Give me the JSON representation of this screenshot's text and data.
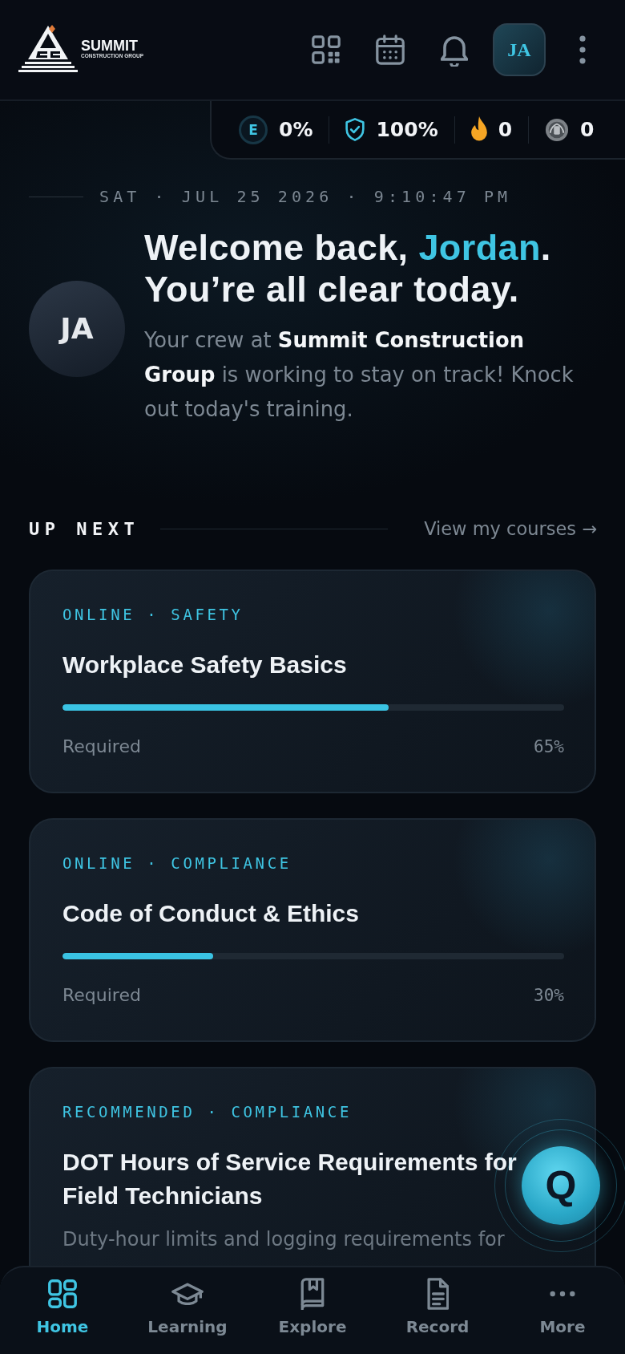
{
  "header": {
    "logo": {
      "name": "SUMMIT",
      "subtitle": "CONSTRUCTION GROUP"
    },
    "avatar_initials": "JA"
  },
  "stats": [
    {
      "kind": "energy",
      "symbol": "E",
      "value": "0%"
    },
    {
      "kind": "shield",
      "value": "100%"
    },
    {
      "kind": "streak",
      "value": "0"
    },
    {
      "kind": "medal",
      "value": "0"
    }
  ],
  "greeting": {
    "date_line": "SAT · JUL 25 2026 · 9:10:47 PM",
    "avatar_initials": "JA",
    "heading_prefix": "Welcome back, ",
    "name": "Jordan",
    "heading_suffix": ".",
    "subheading": "You’re all clear today.",
    "message": "Your crew at **Summit Construction Group** is working to stay on track! Knock out today's training."
  },
  "up_next": {
    "title": "UP NEXT",
    "link": "View my courses →",
    "courses": [
      {
        "tag": "ONLINE · SAFETY",
        "title": "Workplace Safety Basics",
        "level": 0.65,
        "requirement": "Required",
        "percent": "65%"
      },
      {
        "tag": "ONLINE · COMPLIANCE",
        "title": "Code of Conduct & Ethics",
        "level": 0.3,
        "requirement": "Required",
        "percent": "30%"
      },
      {
        "tag": "RECOMMENDED · COMPLIANCE",
        "title": "DOT Hours of Service Requirements for Field Technicians",
        "description": "Duty-hour limits and logging requirements for"
      }
    ]
  },
  "fab": {
    "label": "Q"
  },
  "nav": [
    {
      "kind": "home",
      "label": "Home",
      "selected": true
    },
    {
      "kind": "learning",
      "label": "Learning",
      "selected": false
    },
    {
      "kind": "explore",
      "label": "Explore",
      "selected": false
    },
    {
      "kind": "record",
      "label": "Record",
      "selected": false
    },
    {
      "kind": "more",
      "label": "More",
      "selected": false
    }
  ]
}
